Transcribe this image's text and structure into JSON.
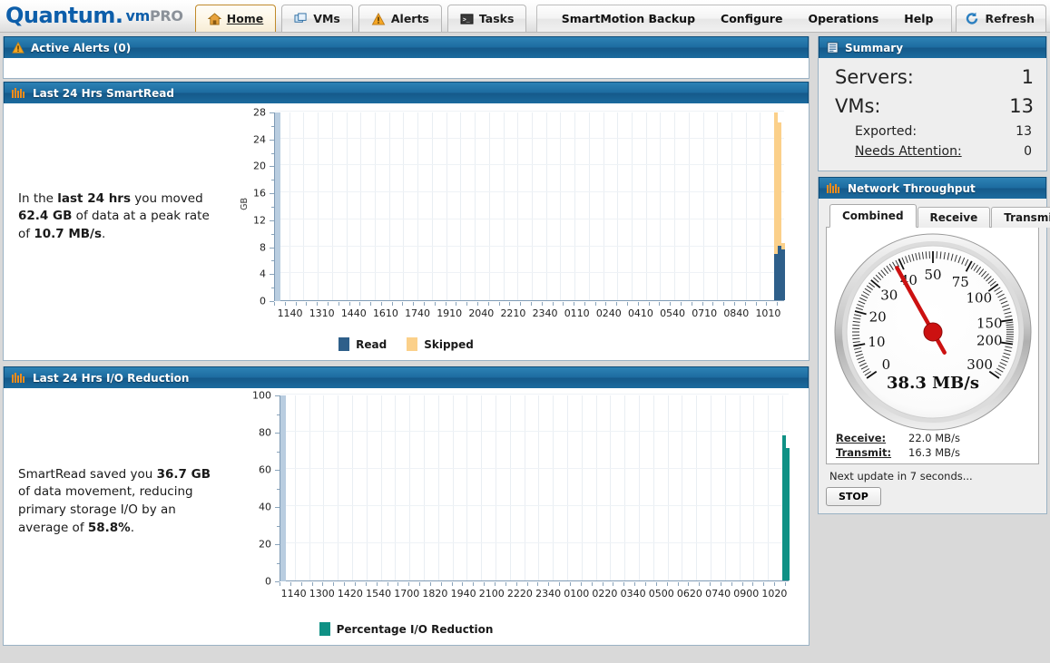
{
  "brand": {
    "name": "Quantum",
    "dot": ".",
    "vm": "vm",
    "pro": "PRO"
  },
  "nav": {
    "tabs": [
      {
        "label": "Home",
        "icon": "home-icon",
        "active": true
      },
      {
        "label": "VMs",
        "icon": "vms-icon",
        "active": false
      },
      {
        "label": "Alerts",
        "icon": "alert-icon",
        "active": false
      },
      {
        "label": "Tasks",
        "icon": "tasks-icon",
        "active": false
      }
    ],
    "menu": [
      "SmartMotion Backup",
      "Configure",
      "Operations",
      "Help"
    ],
    "refresh": {
      "label": "Refresh",
      "icon": "refresh-icon"
    }
  },
  "alerts_panel": {
    "title": "Active Alerts (0)",
    "icon": "warning-icon"
  },
  "smartread_panel": {
    "title": "Last 24 Hrs SmartRead",
    "icon": "chart-icon",
    "summary_parts": [
      {
        "text": "In the ",
        "bold": false
      },
      {
        "text": "last 24 hrs",
        "bold": true
      },
      {
        "text": " you moved ",
        "bold": false
      },
      {
        "text": "62.4 GB",
        "bold": true
      },
      {
        "text": " of data at a peak rate of ",
        "bold": false
      },
      {
        "text": "10.7 MB/s",
        "bold": true
      },
      {
        "text": ".",
        "bold": false
      }
    ]
  },
  "ioreduction_panel": {
    "title": "Last 24 Hrs I/O Reduction",
    "icon": "chart-icon",
    "summary_parts": [
      {
        "text": "SmartRead saved you ",
        "bold": false
      },
      {
        "text": "36.7 GB",
        "bold": true
      },
      {
        "text": " of data movement, reducing primary storage I/O by an average of ",
        "bold": false
      },
      {
        "text": "58.8%",
        "bold": true
      },
      {
        "text": ".",
        "bold": false
      }
    ]
  },
  "summary": {
    "title": "Summary",
    "icon": "list-icon",
    "rows": [
      {
        "label": "Servers:",
        "value": "1",
        "level": "major",
        "link": false
      },
      {
        "label": "VMs:",
        "value": "13",
        "level": "major",
        "link": false
      },
      {
        "label": "Exported:",
        "value": "13",
        "level": "minor",
        "link": false
      },
      {
        "label": "Needs Attention:",
        "value": "0",
        "level": "minor",
        "link": true
      }
    ]
  },
  "network": {
    "title": "Network Throughput",
    "icon": "chart-icon",
    "tabs": [
      {
        "label": "Combined",
        "active": true
      },
      {
        "label": "Receive",
        "active": false
      },
      {
        "label": "Transmit",
        "active": false
      }
    ],
    "gauge": {
      "value": 38.3,
      "value_text": "38.3 MB/s",
      "unit": "MB/s",
      "ticks": [
        0,
        10,
        20,
        30,
        40,
        50,
        75,
        100,
        150,
        200,
        300
      ],
      "needle_color": "#cc1111",
      "scale": "logarithmic"
    },
    "stats": [
      {
        "label": "Receive:",
        "value": "22.0 MB/s"
      },
      {
        "label": "Transmit:",
        "value": "16.3 MB/s"
      }
    ],
    "next_update": "Next update in 7 seconds...",
    "stop_button": "STOP"
  },
  "chart_data": [
    {
      "id": "smartread",
      "type": "bar",
      "stacked": true,
      "title": "Last 24 Hrs SmartRead",
      "xlabel": "",
      "ylabel": "GB",
      "ylim": [
        0,
        28
      ],
      "yticks": [
        0,
        4,
        8,
        12,
        16,
        20,
        24,
        28
      ],
      "xticks": [
        "1140",
        "1310",
        "1440",
        "1610",
        "1740",
        "1910",
        "2040",
        "2210",
        "2340",
        "0110",
        "0240",
        "0410",
        "0540",
        "0710",
        "0840",
        "1010"
      ],
      "grid": true,
      "legend": [
        {
          "name": "Read",
          "color": "#2e5f8a"
        },
        {
          "name": "Skipped",
          "color": "#fbd08a"
        }
      ],
      "series": [
        {
          "name": "Read",
          "color": "#2e5f8a",
          "values": [
            0,
            0,
            0,
            0,
            0,
            0,
            0,
            0,
            0,
            0,
            0,
            0,
            0,
            0,
            0,
            0,
            0,
            0,
            0,
            0,
            0,
            0,
            0,
            0,
            0,
            0,
            0,
            0,
            0,
            0,
            0,
            0,
            0,
            0,
            0,
            0,
            0,
            0,
            0,
            0,
            0,
            0,
            0,
            0,
            0,
            0,
            0,
            0,
            0,
            0,
            0,
            0,
            0,
            0,
            0,
            0,
            0,
            0,
            0,
            0,
            0,
            0,
            0,
            0,
            0,
            0,
            0,
            0,
            0,
            0,
            0,
            0,
            0,
            0,
            0,
            0,
            0,
            0,
            0,
            0,
            0,
            0,
            0,
            0,
            0,
            0,
            0,
            0,
            0,
            0,
            0,
            0,
            0,
            0,
            0,
            0,
            0,
            0,
            0,
            0,
            0,
            0,
            0,
            0,
            0,
            0,
            0,
            0,
            0,
            0,
            0,
            0,
            0,
            0,
            0,
            0,
            0,
            0,
            0,
            0,
            0,
            0,
            0,
            0,
            0,
            0,
            0,
            0,
            0,
            0,
            0,
            0,
            0,
            0,
            0,
            0,
            0,
            0,
            0,
            0,
            6.9,
            8.1,
            7.6
          ]
        },
        {
          "name": "Skipped",
          "color": "#fbd08a",
          "values": [
            0,
            0,
            0,
            0,
            0,
            0,
            0,
            0,
            0,
            0,
            0,
            0,
            0,
            0,
            0,
            0,
            0,
            0,
            0,
            0,
            0,
            0,
            0,
            0,
            0,
            0,
            0,
            0,
            0,
            0,
            0,
            0,
            0,
            0,
            0,
            0,
            0,
            0,
            0,
            0,
            0,
            0,
            0,
            0,
            0,
            0,
            0,
            0,
            0,
            0,
            0,
            0,
            0,
            0,
            0,
            0,
            0,
            0,
            0,
            0,
            0,
            0,
            0,
            0,
            0,
            0,
            0,
            0,
            0,
            0,
            0,
            0,
            0,
            0,
            0,
            0,
            0,
            0,
            0,
            0,
            0,
            0,
            0,
            0,
            0,
            0,
            0,
            0,
            0,
            0,
            0,
            0,
            0,
            0,
            0,
            0,
            0,
            0,
            0,
            0,
            0,
            0,
            0,
            0,
            0,
            0,
            0,
            0,
            0,
            0,
            0,
            0,
            0,
            0,
            0,
            0,
            0,
            0,
            0,
            0,
            0,
            0,
            0,
            0,
            0,
            0,
            0,
            0,
            0,
            0,
            0,
            0,
            0,
            0,
            0,
            0,
            0,
            0,
            0,
            0,
            21.0,
            18.3,
            0.9
          ]
        }
      ],
      "summary_stats": {
        "total_moved": "62.4 GB",
        "peak_rate": "10.7 MB/s",
        "period": "last 24 hrs"
      }
    },
    {
      "id": "ioreduction",
      "type": "bar",
      "stacked": false,
      "title": "Last 24 Hrs I/O Reduction",
      "xlabel": "",
      "ylabel": "",
      "ylim": [
        0,
        100
      ],
      "yticks": [
        0,
        20,
        40,
        60,
        80,
        100
      ],
      "xticks": [
        "1140",
        "1300",
        "1420",
        "1540",
        "1700",
        "1820",
        "1940",
        "2100",
        "2220",
        "2340",
        "0100",
        "0220",
        "0340",
        "0500",
        "0620",
        "0740",
        "0900",
        "1020"
      ],
      "grid": true,
      "legend": [
        {
          "name": "Percentage I/O Reduction",
          "color": "#0f9185"
        }
      ],
      "series": [
        {
          "name": "Percentage I/O Reduction",
          "color": "#0f9185",
          "values": [
            0,
            0,
            0,
            0,
            0,
            0,
            0,
            0,
            0,
            0,
            0,
            0,
            0,
            0,
            0,
            0,
            0,
            0,
            0,
            0,
            0,
            0,
            0,
            0,
            0,
            0,
            0,
            0,
            0,
            0,
            0,
            0,
            0,
            0,
            0,
            0,
            0,
            0,
            0,
            0,
            0,
            0,
            0,
            0,
            0,
            0,
            0,
            0,
            0,
            0,
            0,
            0,
            0,
            0,
            0,
            0,
            0,
            0,
            0,
            0,
            0,
            0,
            0,
            0,
            0,
            0,
            0,
            0,
            0,
            0,
            0,
            0,
            0,
            0,
            0,
            0,
            0,
            0,
            0,
            0,
            0,
            0,
            0,
            0,
            0,
            0,
            0,
            0,
            0,
            0,
            0,
            0,
            0,
            0,
            0,
            0,
            0,
            0,
            0,
            0,
            0,
            0,
            0,
            0,
            0,
            0,
            0,
            0,
            0,
            0,
            0,
            0,
            0,
            0,
            0,
            0,
            0,
            0,
            0,
            0,
            0,
            0,
            0,
            0,
            0,
            0,
            0,
            0,
            0,
            0,
            0,
            0,
            0,
            0,
            0,
            0,
            0,
            0,
            0,
            0,
            78.0,
            71.0
          ]
        }
      ],
      "summary_stats": {
        "saved": "36.7 GB",
        "average_reduction": "58.8%"
      }
    }
  ]
}
